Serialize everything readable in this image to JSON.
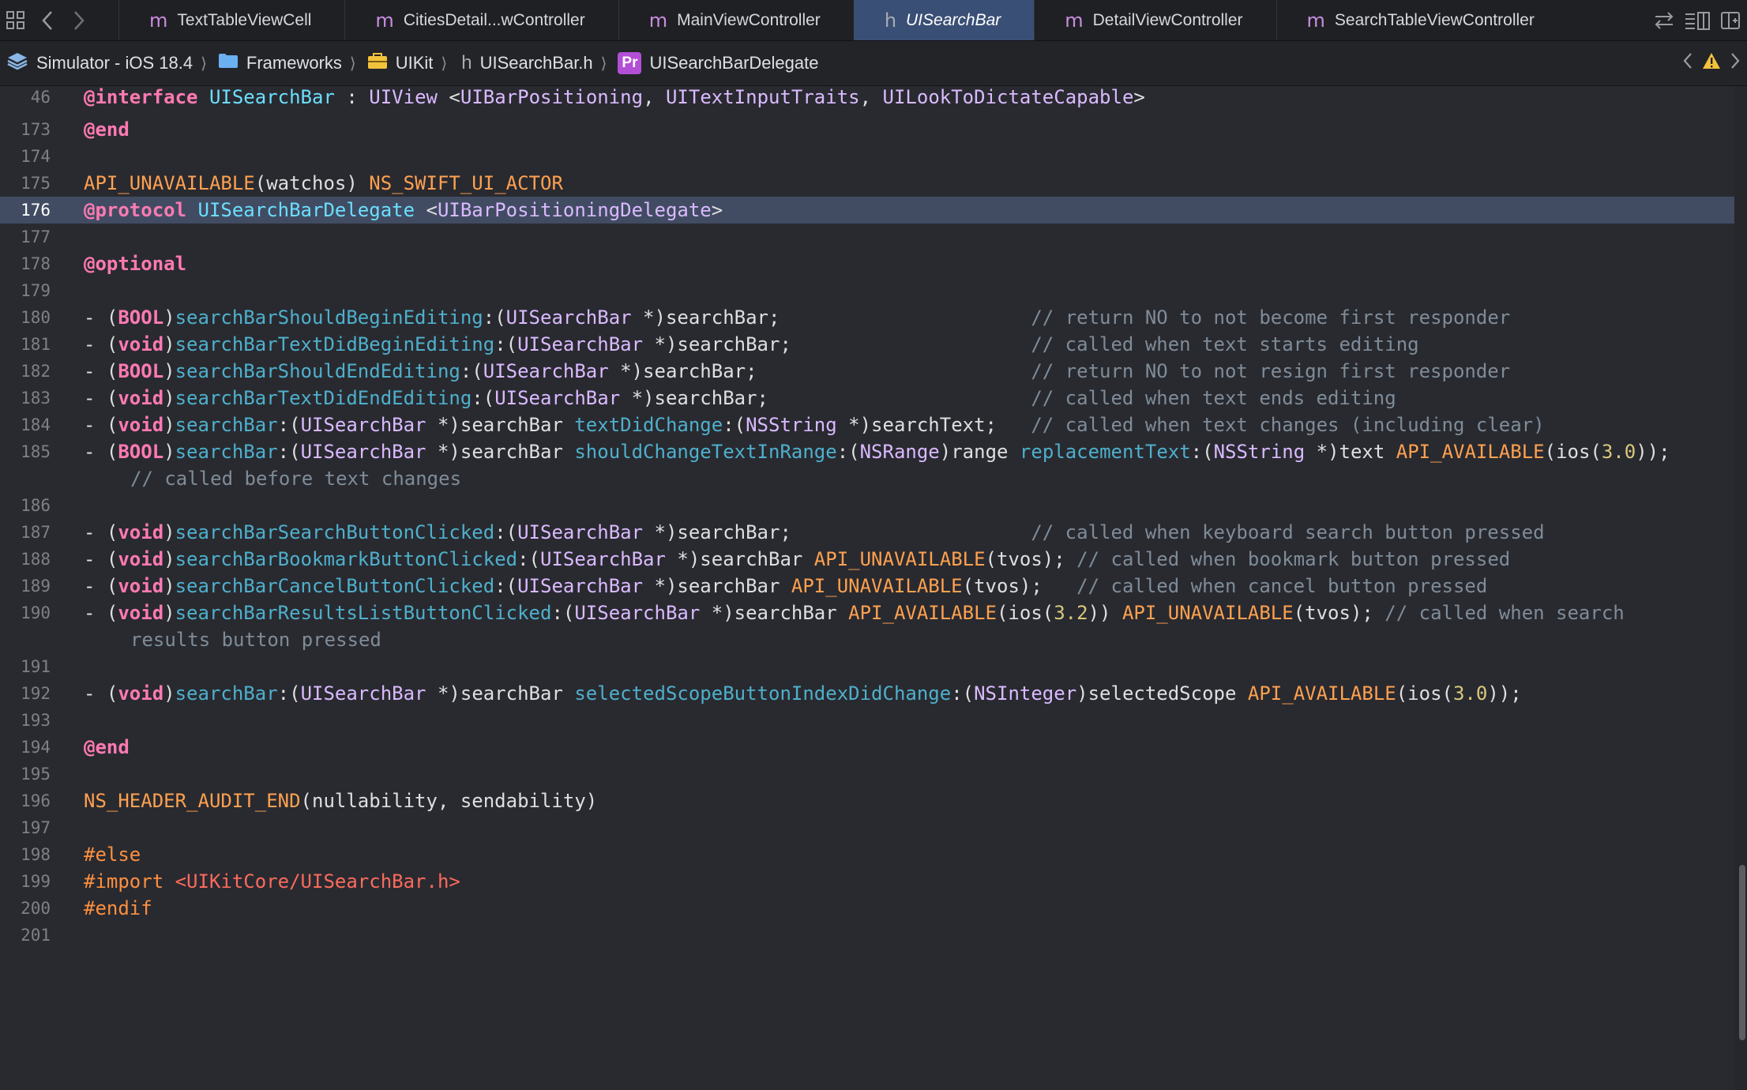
{
  "tabbar": {
    "tabs": [
      {
        "icon": "m",
        "label": "TextTableViewCell",
        "active": false
      },
      {
        "icon": "m",
        "label": "CitiesDetail...wController",
        "active": false
      },
      {
        "icon": "m",
        "label": "MainViewController",
        "active": false
      },
      {
        "icon": "h",
        "label": "UISearchBar",
        "active": true
      },
      {
        "icon": "m",
        "label": "DetailViewController",
        "active": false
      },
      {
        "icon": "m",
        "label": "SearchTableViewController",
        "active": false
      }
    ]
  },
  "jumpbar": {
    "crumbs": [
      "Simulator - iOS 18.4",
      "Frameworks",
      "UIKit",
      "UISearchBar.h",
      "UISearchBarDelegate"
    ],
    "protocol_badge": "Pr",
    "header_badge": "h"
  },
  "editor": {
    "current_line": "176",
    "lines": [
      {
        "n": "46",
        "segs": [
          [
            "kw",
            "@interface"
          ],
          [
            "txt",
            " "
          ],
          [
            "cls",
            "UISearchBar"
          ],
          [
            "txt",
            " : "
          ],
          [
            "typ",
            "UIView"
          ],
          [
            "txt",
            " <"
          ],
          [
            "typ",
            "UIBarPositioning"
          ],
          [
            "txt",
            ", "
          ],
          [
            "typ",
            "UITextInputTraits"
          ],
          [
            "txt",
            ", "
          ],
          [
            "typ",
            "UILookToDictateCapable"
          ],
          [
            "txt",
            ">"
          ]
        ]
      },
      {
        "n": "173",
        "segs": [
          [
            "kw",
            "@end"
          ]
        ]
      },
      {
        "n": "174",
        "segs": []
      },
      {
        "n": "175",
        "segs": [
          [
            "mac",
            "API_UNAVAILABLE"
          ],
          [
            "txt",
            "(watchos) "
          ],
          [
            "mac",
            "NS_SWIFT_UI_ACTOR"
          ]
        ]
      },
      {
        "n": "176",
        "segs": [
          [
            "kw",
            "@protocol"
          ],
          [
            "txt",
            " "
          ],
          [
            "cls",
            "UISearchBarDelegate"
          ],
          [
            "txt",
            " <"
          ],
          [
            "typ",
            "UIBarPositioningDelegate"
          ],
          [
            "txt",
            ">"
          ]
        ]
      },
      {
        "n": "177",
        "segs": []
      },
      {
        "n": "178",
        "segs": [
          [
            "kw",
            "@optional"
          ]
        ]
      },
      {
        "n": "179",
        "segs": []
      },
      {
        "n": "180",
        "segs": [
          [
            "txt",
            "- ("
          ],
          [
            "kw",
            "BOOL"
          ],
          [
            "txt",
            ")"
          ],
          [
            "fn",
            "searchBarShouldBeginEditing"
          ],
          [
            "txt",
            ":("
          ],
          [
            "typ",
            "UISearchBar"
          ],
          [
            "txt",
            " *)searchBar;                      "
          ],
          [
            "cm",
            "// return NO to not become first responder"
          ]
        ]
      },
      {
        "n": "181",
        "segs": [
          [
            "txt",
            "- ("
          ],
          [
            "kw",
            "void"
          ],
          [
            "txt",
            ")"
          ],
          [
            "fn",
            "searchBarTextDidBeginEditing"
          ],
          [
            "txt",
            ":("
          ],
          [
            "typ",
            "UISearchBar"
          ],
          [
            "txt",
            " *)searchBar;                     "
          ],
          [
            "cm",
            "// called when text starts editing"
          ]
        ]
      },
      {
        "n": "182",
        "segs": [
          [
            "txt",
            "- ("
          ],
          [
            "kw",
            "BOOL"
          ],
          [
            "txt",
            ")"
          ],
          [
            "fn",
            "searchBarShouldEndEditing"
          ],
          [
            "txt",
            ":("
          ],
          [
            "typ",
            "UISearchBar"
          ],
          [
            "txt",
            " *)searchBar;                        "
          ],
          [
            "cm",
            "// return NO to not resign first responder"
          ]
        ]
      },
      {
        "n": "183",
        "segs": [
          [
            "txt",
            "- ("
          ],
          [
            "kw",
            "void"
          ],
          [
            "txt",
            ")"
          ],
          [
            "fn",
            "searchBarTextDidEndEditing"
          ],
          [
            "txt",
            ":("
          ],
          [
            "typ",
            "UISearchBar"
          ],
          [
            "txt",
            " *)searchBar;                       "
          ],
          [
            "cm",
            "// called when text ends editing"
          ]
        ]
      },
      {
        "n": "184",
        "segs": [
          [
            "txt",
            "- ("
          ],
          [
            "kw",
            "void"
          ],
          [
            "txt",
            ")"
          ],
          [
            "fn",
            "searchBar"
          ],
          [
            "txt",
            ":("
          ],
          [
            "typ",
            "UISearchBar"
          ],
          [
            "txt",
            " *)searchBar "
          ],
          [
            "fn",
            "textDidChange"
          ],
          [
            "txt",
            ":("
          ],
          [
            "typ",
            "NSString"
          ],
          [
            "txt",
            " *)searchText;   "
          ],
          [
            "cm",
            "// called when text changes (including clear)"
          ]
        ]
      },
      {
        "n": "185",
        "segs": [
          [
            "txt",
            "- ("
          ],
          [
            "kw",
            "BOOL"
          ],
          [
            "txt",
            ")"
          ],
          [
            "fn",
            "searchBar"
          ],
          [
            "txt",
            ":("
          ],
          [
            "typ",
            "UISearchBar"
          ],
          [
            "txt",
            " *)searchBar "
          ],
          [
            "fn",
            "shouldChangeTextInRange"
          ],
          [
            "txt",
            ":("
          ],
          [
            "typ",
            "NSRange"
          ],
          [
            "txt",
            ")range "
          ],
          [
            "fn",
            "replacementText"
          ],
          [
            "txt",
            ":("
          ],
          [
            "typ",
            "NSString"
          ],
          [
            "txt",
            " *)text "
          ],
          [
            "mac",
            "API_AVAILABLE"
          ],
          [
            "txt",
            "(ios("
          ],
          [
            "numl",
            "3.0"
          ],
          [
            "txt",
            "));"
          ]
        ],
        "cont": [
          [
            "cm",
            "// called before text changes"
          ]
        ]
      },
      {
        "n": "186",
        "segs": []
      },
      {
        "n": "187",
        "segs": [
          [
            "txt",
            "- ("
          ],
          [
            "kw",
            "void"
          ],
          [
            "txt",
            ")"
          ],
          [
            "fn",
            "searchBarSearchButtonClicked"
          ],
          [
            "txt",
            ":("
          ],
          [
            "typ",
            "UISearchBar"
          ],
          [
            "txt",
            " *)searchBar;                     "
          ],
          [
            "cm",
            "// called when keyboard search button pressed"
          ]
        ]
      },
      {
        "n": "188",
        "segs": [
          [
            "txt",
            "- ("
          ],
          [
            "kw",
            "void"
          ],
          [
            "txt",
            ")"
          ],
          [
            "fn",
            "searchBarBookmarkButtonClicked"
          ],
          [
            "txt",
            ":("
          ],
          [
            "typ",
            "UISearchBar"
          ],
          [
            "txt",
            " *)searchBar "
          ],
          [
            "mac",
            "API_UNAVAILABLE"
          ],
          [
            "txt",
            "(tvos); "
          ],
          [
            "cm",
            "// called when bookmark button pressed"
          ]
        ]
      },
      {
        "n": "189",
        "segs": [
          [
            "txt",
            "- ("
          ],
          [
            "kw",
            "void"
          ],
          [
            "txt",
            ")"
          ],
          [
            "fn",
            "searchBarCancelButtonClicked"
          ],
          [
            "txt",
            ":("
          ],
          [
            "typ",
            "UISearchBar"
          ],
          [
            "txt",
            " *)searchBar "
          ],
          [
            "mac",
            "API_UNAVAILABLE"
          ],
          [
            "txt",
            "(tvos);   "
          ],
          [
            "cm",
            "// called when cancel button pressed"
          ]
        ]
      },
      {
        "n": "190",
        "segs": [
          [
            "txt",
            "- ("
          ],
          [
            "kw",
            "void"
          ],
          [
            "txt",
            ")"
          ],
          [
            "fn",
            "searchBarResultsListButtonClicked"
          ],
          [
            "txt",
            ":("
          ],
          [
            "typ",
            "UISearchBar"
          ],
          [
            "txt",
            " *)searchBar "
          ],
          [
            "mac",
            "API_AVAILABLE"
          ],
          [
            "txt",
            "(ios("
          ],
          [
            "numl",
            "3.2"
          ],
          [
            "txt",
            ")) "
          ],
          [
            "mac",
            "API_UNAVAILABLE"
          ],
          [
            "txt",
            "(tvos); "
          ],
          [
            "cm",
            "// called when search"
          ]
        ],
        "cont": [
          [
            "cm",
            "results button pressed"
          ]
        ]
      },
      {
        "n": "191",
        "segs": []
      },
      {
        "n": "192",
        "segs": [
          [
            "txt",
            "- ("
          ],
          [
            "kw",
            "void"
          ],
          [
            "txt",
            ")"
          ],
          [
            "fn",
            "searchBar"
          ],
          [
            "txt",
            ":("
          ],
          [
            "typ",
            "UISearchBar"
          ],
          [
            "txt",
            " *)searchBar "
          ],
          [
            "fn",
            "selectedScopeButtonIndexDidChange"
          ],
          [
            "txt",
            ":("
          ],
          [
            "typ",
            "NSInteger"
          ],
          [
            "txt",
            ")selectedScope "
          ],
          [
            "mac",
            "API_AVAILABLE"
          ],
          [
            "txt",
            "(ios("
          ],
          [
            "numl",
            "3.0"
          ],
          [
            "txt",
            "));"
          ]
        ]
      },
      {
        "n": "193",
        "segs": []
      },
      {
        "n": "194",
        "segs": [
          [
            "kw",
            "@end"
          ]
        ]
      },
      {
        "n": "195",
        "segs": []
      },
      {
        "n": "196",
        "segs": [
          [
            "mac",
            "NS_HEADER_AUDIT_END"
          ],
          [
            "txt",
            "(nullability, sendability)"
          ]
        ]
      },
      {
        "n": "197",
        "segs": []
      },
      {
        "n": "198",
        "segs": [
          [
            "pp",
            "#else"
          ]
        ]
      },
      {
        "n": "199",
        "segs": [
          [
            "pp",
            "#import"
          ],
          [
            "txt",
            " "
          ],
          [
            "str",
            "<UIKitCore/UISearchBar.h>"
          ]
        ]
      },
      {
        "n": "200",
        "segs": [
          [
            "pp",
            "#endif"
          ]
        ]
      },
      {
        "n": "201",
        "segs": []
      }
    ]
  }
}
